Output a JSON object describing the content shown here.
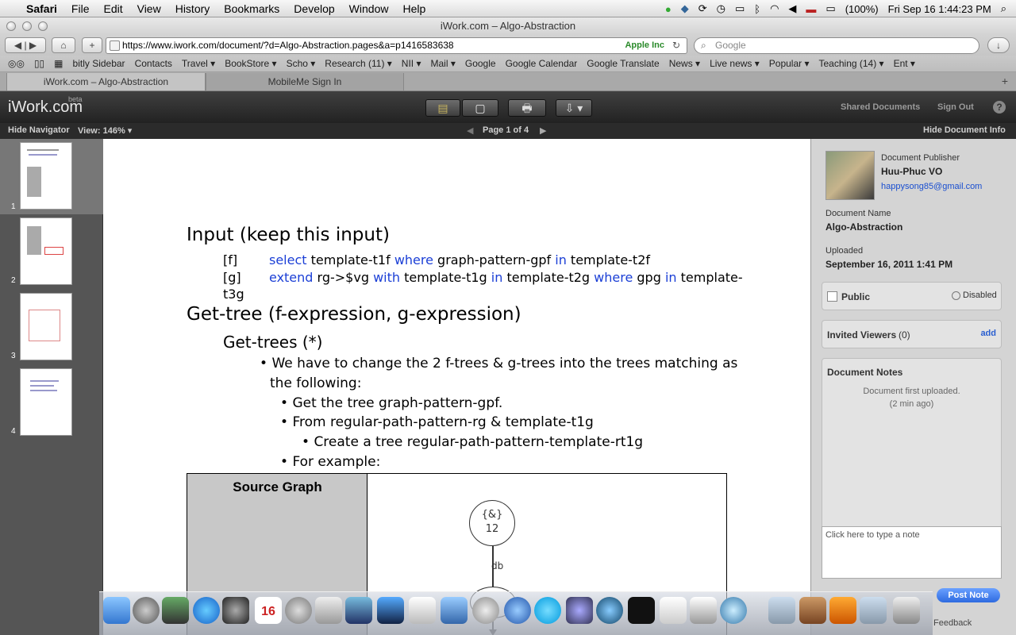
{
  "menubar": {
    "app": "Safari",
    "items": [
      "File",
      "Edit",
      "View",
      "History",
      "Bookmarks",
      "Develop",
      "Window",
      "Help"
    ],
    "battery": "(100%)",
    "clock": "Fri Sep 16  1:44:23 PM"
  },
  "window": {
    "title": "iWork.com – Algo-Abstraction"
  },
  "toolbar": {
    "url": "https://www.iwork.com/document/?d=Algo-Abstraction.pages&a=p1416583638",
    "cert": "Apple Inc",
    "search_placeholder": "Google"
  },
  "bookmarks": [
    "bitly Sidebar",
    "Contacts",
    "Travel ▾",
    "BookStore ▾",
    "Scho ▾",
    "Research (11) ▾",
    "NII ▾",
    "Mail ▾",
    "Google",
    "Google Calendar",
    "Google Translate",
    "News ▾",
    "Live news ▾",
    "Popular ▾",
    "Teaching (14) ▾",
    "Ent ▾"
  ],
  "tabs": [
    "iWork.com – Algo-Abstraction",
    "MobileMe Sign In"
  ],
  "iwork": {
    "logo": "iWork.com",
    "beta": "beta",
    "shared": "Shared Documents",
    "signout": "Sign Out",
    "help": "?",
    "hide_nav": "Hide Navigator",
    "view": "View: 146% ▾",
    "page": "Page 1 of 4",
    "hide_info": "Hide Document Info"
  },
  "navigator": {
    "pages": [
      "1",
      "2",
      "3",
      "4"
    ]
  },
  "doc": {
    "h_input": "Input (keep this input)",
    "f_tag": "[f]",
    "f_kw1": "select",
    "f_t1": " template-t1f ",
    "f_kw2": "where",
    "f_t2": " graph-pattern-gpf ",
    "f_kw3": "in",
    "f_t3": " template-t2f",
    "g_tag": "[g]",
    "g_kw1": "extend",
    "g_t1": " rg->$vg ",
    "g_kw2": "with",
    "g_t2": " template-t1g ",
    "g_kw3": "in",
    "g_t3": " template-t2g ",
    "g_kw4": "where",
    "g_t4": " gpg ",
    "g_kw5": "in",
    "g_t5": " template-",
    "g_wrap": "t3g",
    "h_gettree": "Get-tree (f-expression, g-expression)",
    "h_gettrees": "Get-trees (*)",
    "b1": "We have to change the 2 f-trees & g-trees into the trees matching as",
    "b1b": "the following:",
    "b2": "Get the tree graph-pattern-gpf.",
    "b3": "From regular-path-pattern-rg & template-t1g",
    "b4": "Create a tree regular-path-pattern-template-rt1g",
    "b5": "For example:",
    "tbl_header": "Source Graph",
    "node_label": "{&}",
    "node_num": "12",
    "edge_label": "db"
  },
  "info": {
    "publisher_label": "Document Publisher",
    "publisher": "Huu-Phuc VO",
    "email": "happysong85@gmail.com",
    "name_label": "Document Name",
    "name": "Algo-Abstraction",
    "uploaded_label": "Uploaded",
    "uploaded": "September 16, 2011 1:41 PM",
    "public": "Public",
    "disabled": "Disabled",
    "invited": "Invited Viewers",
    "invited_count": "(0)",
    "add": "add",
    "notes_title": "Document Notes",
    "notes_1": "Document first uploaded.",
    "notes_2": "(2 min ago)",
    "note_placeholder": "Click here to type a note",
    "post": "Post Note",
    "feedback": "Feedback"
  }
}
